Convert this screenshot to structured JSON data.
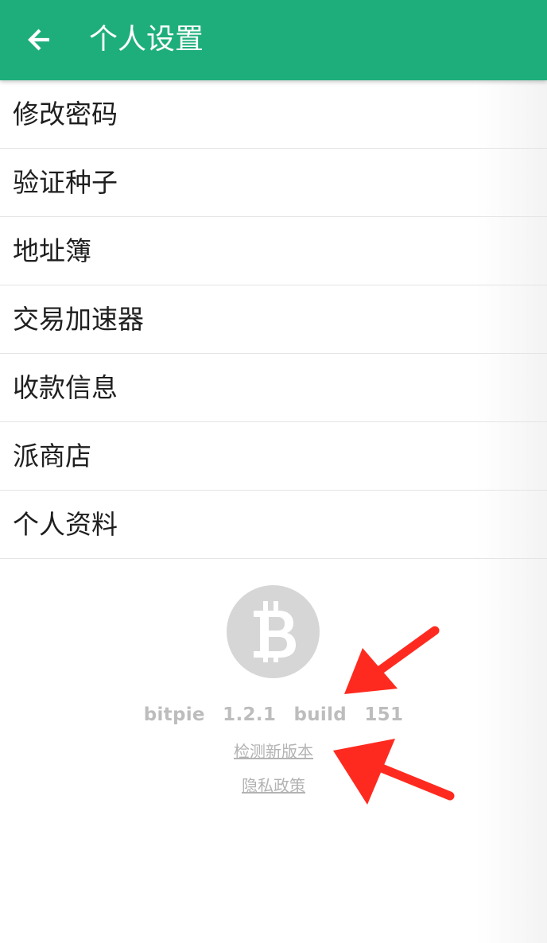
{
  "header": {
    "title": "个人设置",
    "back_icon": "arrow-left-icon",
    "background_color": "#1eae7b"
  },
  "menu": {
    "items": [
      {
        "label": "修改密码"
      },
      {
        "label": "验证种子"
      },
      {
        "label": "地址簿"
      },
      {
        "label": "交易加速器"
      },
      {
        "label": "收款信息"
      },
      {
        "label": "派商店"
      },
      {
        "label": "个人资料"
      }
    ]
  },
  "about": {
    "logo_icon": "bitcoin-logo-icon",
    "app_name": "bitpie",
    "version": "1.2.1",
    "build_label": "build",
    "build_number": "151",
    "check_update_label": "检测新版本",
    "privacy_policy_label": "隐私政策"
  },
  "annotations": {
    "arrow_color": "#ff2a1f"
  }
}
